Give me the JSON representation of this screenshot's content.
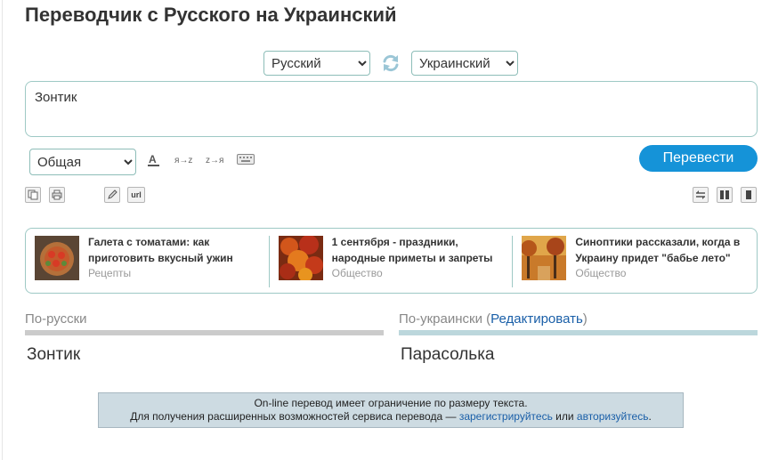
{
  "page": {
    "title": "Переводчик с Русского на Украинский"
  },
  "languages": {
    "from_options": [
      "Русский"
    ],
    "from_selected": "Русский",
    "to_options": [
      "Украинский"
    ],
    "to_selected": "Украинский"
  },
  "input": {
    "value": "Зонтик"
  },
  "toolbar": {
    "topic_options": [
      "Общая"
    ],
    "topic_selected": "Общая",
    "ya_z": "я→z",
    "z_ya": "z→я",
    "translate_label": "Перевести",
    "url_label": "url"
  },
  "news": [
    {
      "title": "Галета с томатами: как приготовить вкусный ужин",
      "category": "Рецепты"
    },
    {
      "title": "1 сентября - праздники, народные приметы и запреты",
      "category": "Общество"
    },
    {
      "title": "Синоптики рассказали, когда в Украину придет \"бабье лето\"",
      "category": "Общество"
    }
  ],
  "columns": {
    "source_head": "По-русски",
    "target_head": "По-украински",
    "edit_open": "(",
    "edit_label": "Редактировать",
    "edit_close": ")",
    "source_text": "Зонтик",
    "target_text": "Парасолька"
  },
  "notice": {
    "line1": "On-line перевод имеет ограничение по размеру текста.",
    "line2_prefix": "Для получения расширенных возможностей сервиса перевода — ",
    "register_link": "зарегистрируйтесь",
    "or_word": " или ",
    "login_link": "авторизуйтесь",
    "period": "."
  },
  "colors": {
    "accent": "#1593d8",
    "border": "#9ec9c5",
    "notice_bg": "#cddbe2",
    "link": "#1a5fa8"
  }
}
